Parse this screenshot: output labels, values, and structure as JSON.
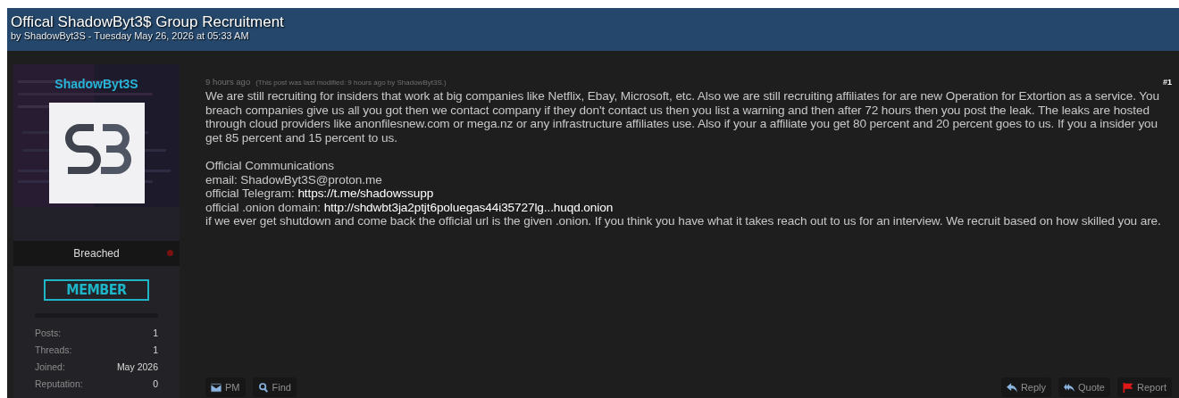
{
  "thread": {
    "title": "Offical ShadowByt3$ Group Recruitment",
    "byline": "by ShadowByt3S - Tuesday May 26, 2026 at 05:33 AM"
  },
  "author": {
    "username": "ShadowByt3S",
    "group": "Breached",
    "online": false,
    "rank": "MEMBER",
    "stats": [
      {
        "label": "Posts:",
        "value": "1"
      },
      {
        "label": "Threads:",
        "value": "1"
      },
      {
        "label": "Joined:",
        "value": "May 2026"
      },
      {
        "label": "Reputation:",
        "value": "0"
      }
    ]
  },
  "post": {
    "time": "9 hours ago",
    "edited": "(This post was last modified: 9 hours ago by ShadowByt3S.)",
    "number": "#1",
    "body": "We are still recruiting for insiders that work at big companies like Netflix, Ebay, Microsoft, etc. Also we are still recruiting affiliates for are new Operation for Extortion as a service. You breach companies give us all you got then we contact company if they don't contact us then you list a warning and then after 72 hours then you post the leak. The leaks are hosted through cloud providers like anonfilesnew.com or mega.nz or any infrastructure affiliates use. Also if your a affiliate you get 80 percent and 20 percent goes to us. If you a insider you get 85 percent and 15 percent to us.",
    "lines": [
      {
        "text": "Official Communications"
      },
      {
        "text": "email: ShadowByt3S@proton.me"
      },
      {
        "text": "official Telegram:",
        "link": "https://t.me/shadowssupp"
      },
      {
        "text": "official .onion domain:",
        "link": "http://shdwbt3ja2ptjt6poluegas44i35727lg...huqd.onion"
      },
      {
        "text": "if we ever get shutdown and come back the official url is the given .onion. If you think you have what it takes reach out to us for an interview. We recruit based on how skilled you are."
      }
    ],
    "left_buttons": [
      {
        "kind": "mail",
        "label": "PM"
      },
      {
        "kind": "search",
        "label": "Find"
      }
    ],
    "right_buttons": [
      {
        "kind": "reply",
        "label": "Reply"
      },
      {
        "kind": "quote",
        "label": "Quote"
      },
      {
        "kind": "flag",
        "label": "Report"
      }
    ]
  }
}
